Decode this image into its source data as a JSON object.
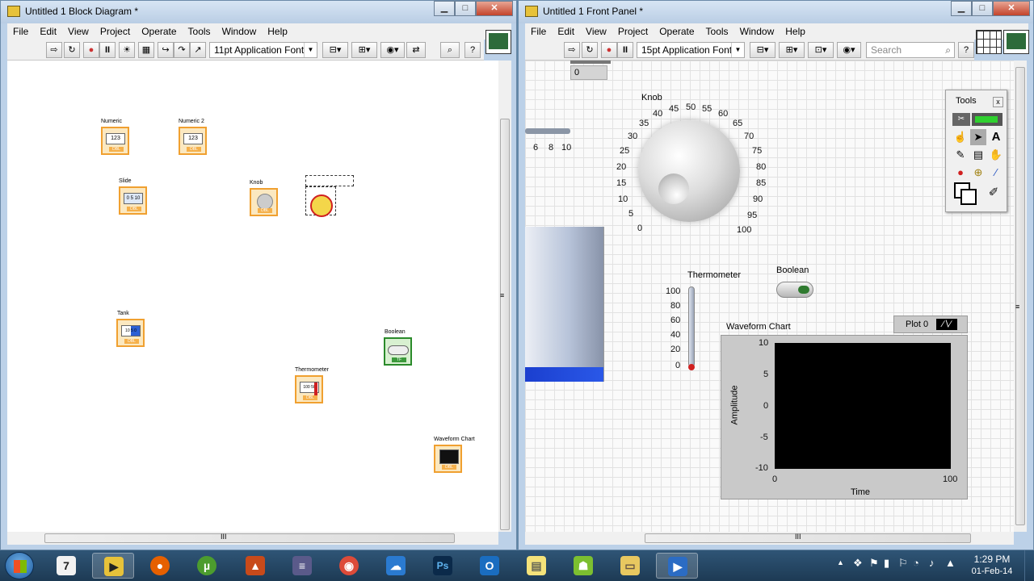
{
  "block_diagram": {
    "title": "Untitled 1 Block Diagram *",
    "menu": [
      "File",
      "Edit",
      "View",
      "Project",
      "Operate",
      "Tools",
      "Window",
      "Help"
    ],
    "font_select": "11pt Application Font",
    "nodes": [
      {
        "label": "Numeric",
        "inner": "123"
      },
      {
        "label": "Numeric 2",
        "inner": "123"
      },
      {
        "label": "Slide",
        "inner": "0  5  10"
      },
      {
        "label": "Knob",
        "inner": ""
      },
      {
        "label": "Tank",
        "inner": "10 5 0"
      },
      {
        "label": "Boolean",
        "inner": ""
      },
      {
        "label": "Thermometer",
        "inner": "100 50"
      },
      {
        "label": "Waveform Chart",
        "inner": ""
      }
    ],
    "dbl_tag": "DBL",
    "tf_tag": "TF",
    "scroll_marker": "III",
    "scroll_marker_v": "≡"
  },
  "front_panel": {
    "title": "Untitled 1 Front Panel *",
    "menu": [
      "File",
      "Edit",
      "View",
      "Project",
      "Operate",
      "Tools",
      "Window",
      "Help"
    ],
    "font_select": "15pt Application Font",
    "search_placeholder": "Search",
    "numeric_value": "0",
    "slide_ticks": [
      "6",
      "8",
      "10"
    ],
    "knob": {
      "label": "Knob",
      "ticks": [
        "0",
        "5",
        "10",
        "15",
        "20",
        "25",
        "30",
        "35",
        "40",
        "45",
        "50",
        "55",
        "60",
        "65",
        "70",
        "75",
        "80",
        "85",
        "90",
        "95",
        "100"
      ]
    },
    "thermometer": {
      "label": "Thermometer",
      "ticks": [
        "100",
        "80",
        "60",
        "40",
        "20",
        "0"
      ]
    },
    "boolean_label": "Boolean",
    "chart": {
      "title": "Waveform Chart",
      "plot_legend": "Plot 0",
      "ylabel": "Amplitude",
      "xlabel": "Time",
      "yticks": [
        "10",
        "5",
        "0",
        "-5",
        "-10"
      ],
      "xticks": [
        "0",
        "100"
      ]
    },
    "tools_palette": {
      "title": "Tools",
      "close": "x"
    }
  },
  "taskbar": {
    "time": "1:29 PM",
    "date": "01-Feb-14",
    "apps": [
      {
        "name": "labview-icon",
        "glyph": "7"
      },
      {
        "name": "labview-running-icon",
        "glyph": "▶"
      },
      {
        "name": "firefox-icon",
        "glyph": "●"
      },
      {
        "name": "utorrent-icon",
        "glyph": "µ"
      },
      {
        "name": "matlab-icon",
        "glyph": "▲"
      },
      {
        "name": "app-grid-icon",
        "glyph": "≡"
      },
      {
        "name": "chrome-icon",
        "glyph": "◉"
      },
      {
        "name": "onedrive-icon",
        "glyph": "☁"
      },
      {
        "name": "photoshop-icon",
        "glyph": "Ps"
      },
      {
        "name": "outlook-icon",
        "glyph": "O"
      },
      {
        "name": "sticky-notes-icon",
        "glyph": "▤"
      },
      {
        "name": "android-icon",
        "glyph": "☗"
      },
      {
        "name": "explorer-icon",
        "glyph": "▭"
      },
      {
        "name": "media-player-icon",
        "glyph": "▶"
      }
    ]
  }
}
